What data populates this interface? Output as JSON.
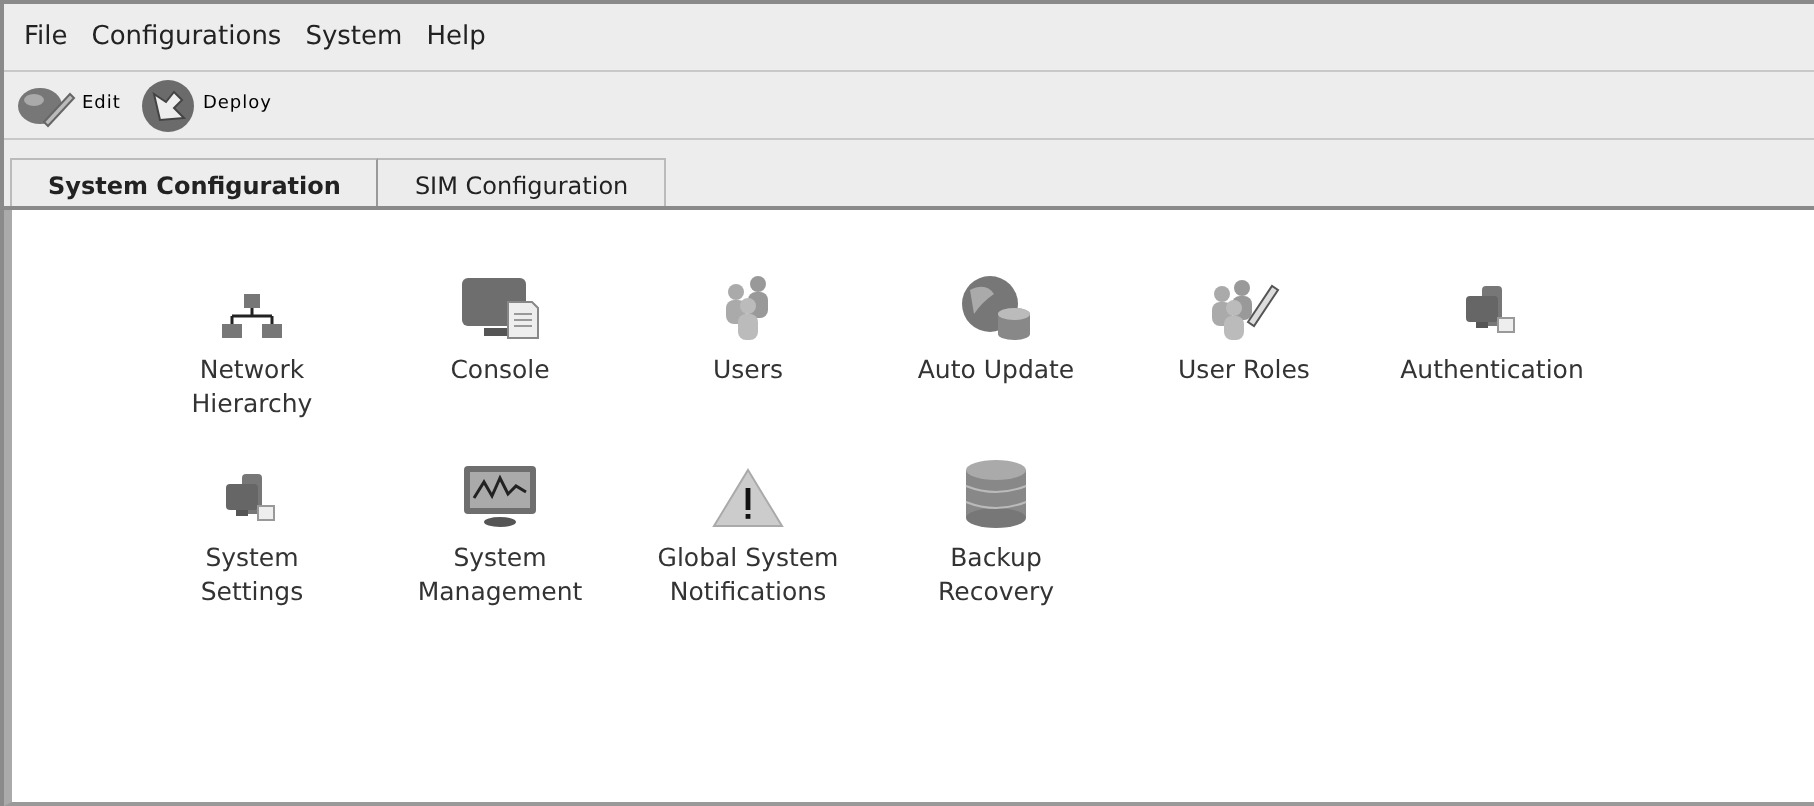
{
  "menu": [
    "File",
    "Configurations",
    "System",
    "Help"
  ],
  "toolbar": [
    {
      "label": "Edit",
      "kind": "edit"
    },
    {
      "label": "Deploy",
      "kind": "deploy"
    }
  ],
  "tabs": [
    {
      "label": "System Configuration",
      "selected": true
    },
    {
      "label": "SIM Configuration",
      "selected": false
    }
  ],
  "items": [
    {
      "label": "Network\nHierarchy",
      "kind": "network"
    },
    {
      "label": "Console",
      "kind": "console"
    },
    {
      "label": "Users",
      "kind": "users"
    },
    {
      "label": "Auto Update",
      "kind": "globe"
    },
    {
      "label": "User Roles",
      "kind": "roles"
    },
    {
      "label": "Authentication",
      "kind": "computers"
    },
    {
      "label": "System\nSettings",
      "kind": "computers"
    },
    {
      "label": "System\nManagement",
      "kind": "monitor"
    },
    {
      "label": "Global System\nNotifications",
      "kind": "warning"
    },
    {
      "label": "Backup\nRecovery",
      "kind": "database"
    }
  ]
}
